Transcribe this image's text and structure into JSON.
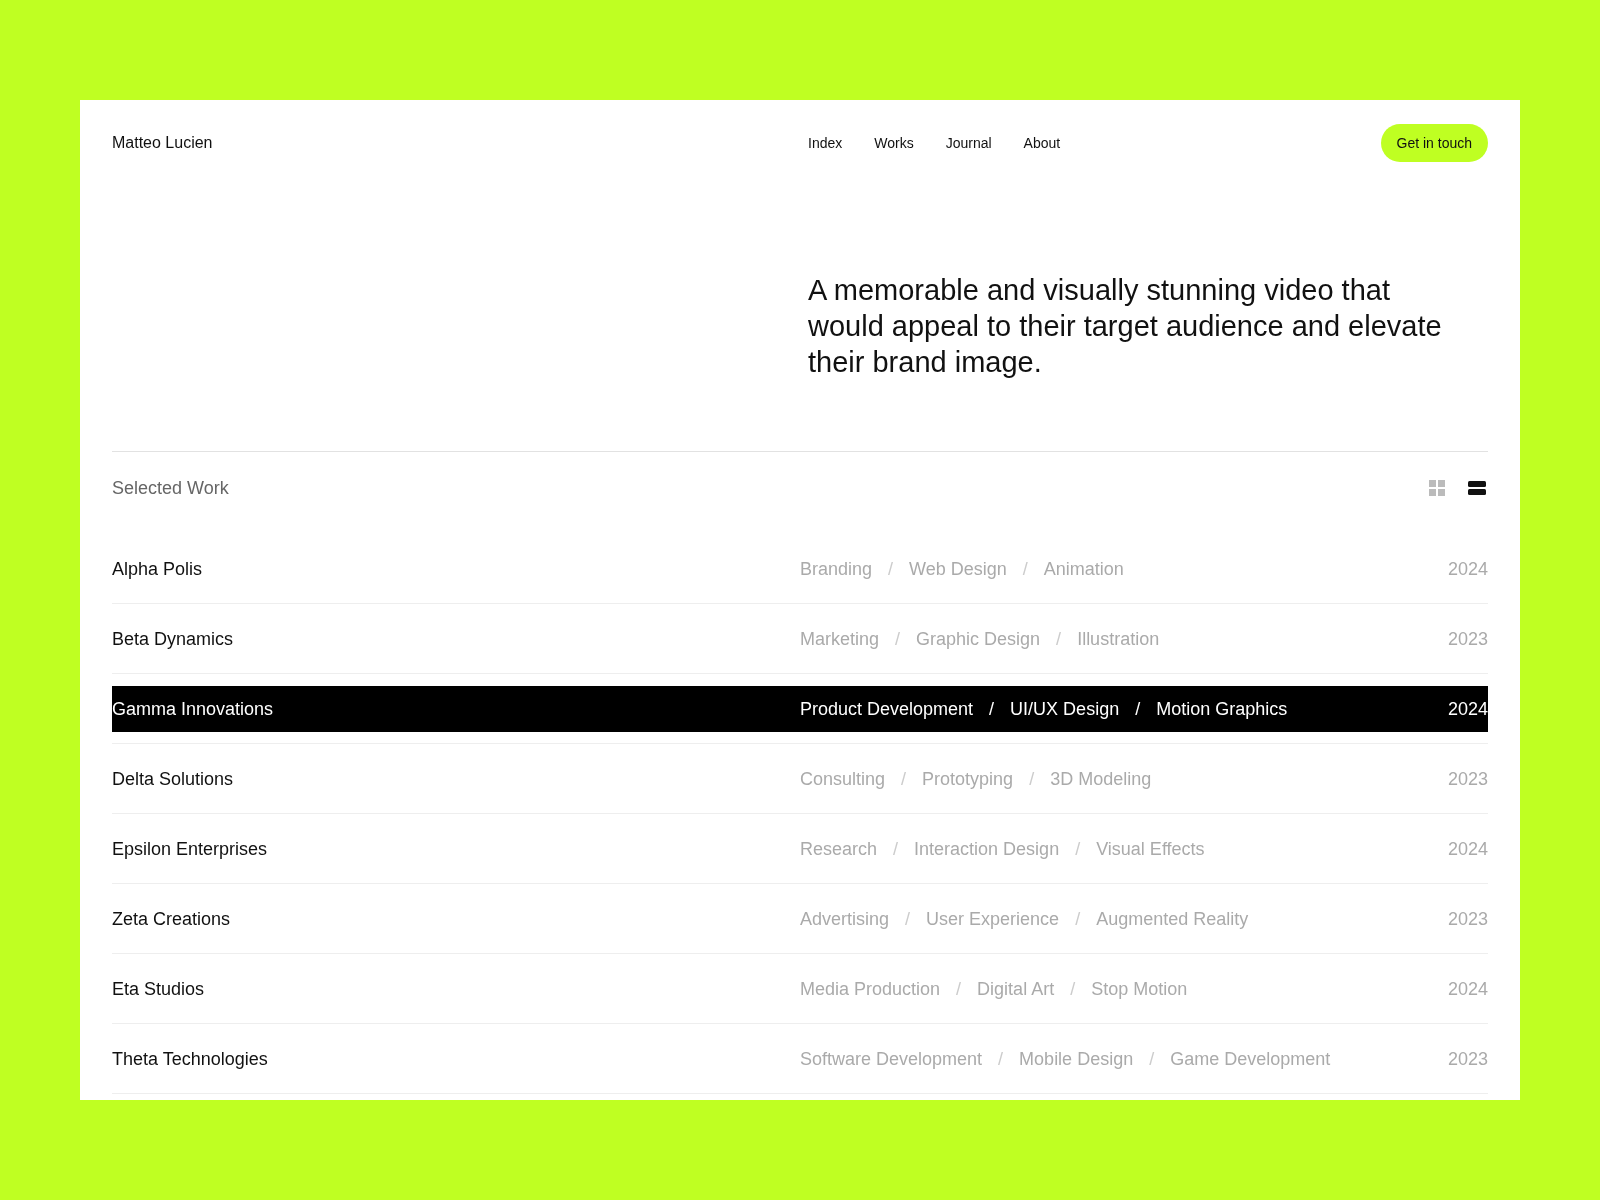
{
  "header": {
    "brand": "Matteo Lucien",
    "nav": [
      {
        "label": "Index"
      },
      {
        "label": "Works"
      },
      {
        "label": "Journal"
      },
      {
        "label": "About"
      }
    ],
    "cta": "Get in touch"
  },
  "hero": {
    "headline": "A memorable and visually stunning video that would appeal to their target audience and elevate their brand image."
  },
  "work": {
    "title": "Selected Work",
    "views": [
      {
        "kind": "grid",
        "selected": false
      },
      {
        "kind": "list",
        "selected": true
      }
    ],
    "rows": [
      {
        "name": "Alpha Polis",
        "tags": [
          "Branding",
          "/",
          "Web Design",
          "/",
          "Animation"
        ],
        "year": "2024",
        "selected": false
      },
      {
        "name": "Beta Dynamics",
        "tags": [
          "Marketing",
          "/",
          "Graphic Design",
          "/",
          "Illustration"
        ],
        "year": "2023",
        "selected": false
      },
      {
        "name": "Gamma Innovations",
        "tags": [
          "Product Development",
          "/",
          "UI/UX Design",
          "/",
          "Motion Graphics"
        ],
        "year": "2024",
        "selected": true
      },
      {
        "name": "Delta Solutions",
        "tags": [
          "Consulting",
          "/",
          "Prototyping",
          "/",
          "3D Modeling"
        ],
        "year": "2023",
        "selected": false
      },
      {
        "name": "Epsilon Enterprises",
        "tags": [
          "Research",
          "/",
          "Interaction Design",
          "/",
          "Visual Effects"
        ],
        "year": "2024",
        "selected": false
      },
      {
        "name": "Zeta Creations",
        "tags": [
          "Advertising",
          "/",
          "User Experience",
          "/",
          "Augmented Reality"
        ],
        "year": "2023",
        "selected": false
      },
      {
        "name": "Eta Studios",
        "tags": [
          "Media Production",
          "/",
          "Digital Art",
          "/",
          "Stop Motion"
        ],
        "year": "2024",
        "selected": false
      },
      {
        "name": "Theta Technologies",
        "tags": [
          "Software Development",
          "/",
          "Mobile Design",
          "/",
          "Game Development"
        ],
        "year": "2023",
        "selected": false
      }
    ]
  }
}
